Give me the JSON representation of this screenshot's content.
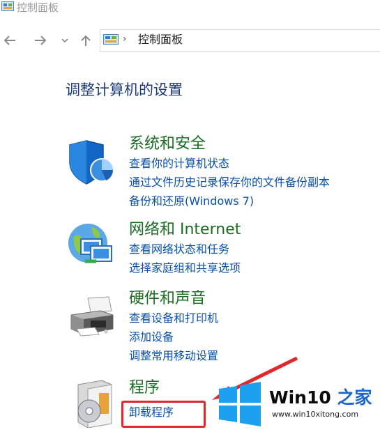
{
  "window": {
    "title": "控制面板"
  },
  "nav": {
    "breadcrumb": "控制面板"
  },
  "main": {
    "heading": "调整计算机的设置"
  },
  "categories": [
    {
      "title": "系统和安全",
      "icon": "shield-icon",
      "links": [
        "查看你的计算机状态",
        "通过文件历史记录保存你的文件备份副本",
        "备份和还原(Windows 7)"
      ]
    },
    {
      "title": "网络和 Internet",
      "icon": "network-globe-icon",
      "links": [
        "查看网络状态和任务",
        "选择家庭组和共享选项"
      ]
    },
    {
      "title": "硬件和声音",
      "icon": "printer-icon",
      "links": [
        "查看设备和打印机",
        "添加设备",
        "调整常用移动设置"
      ]
    },
    {
      "title": "程序",
      "icon": "programs-cd-icon",
      "links": [
        "卸载程序"
      ]
    }
  ],
  "watermark": {
    "brand_main": "Win10",
    "brand_accent": "之家",
    "url": "www.win10xitong.com"
  },
  "colors": {
    "category_title": "#1a6d22",
    "link": "#0a4fa8",
    "heading": "#1e3a78",
    "highlight": "#e0282a"
  }
}
